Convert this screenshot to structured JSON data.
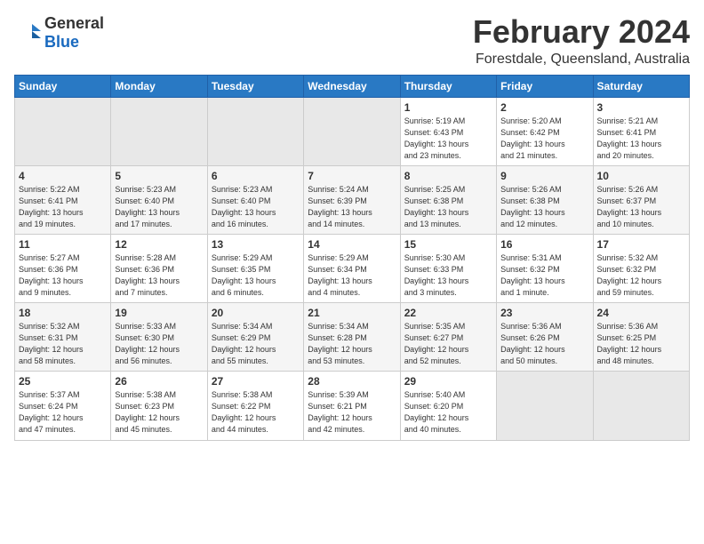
{
  "header": {
    "logo": {
      "text_general": "General",
      "text_blue": "Blue"
    },
    "month_title": "February 2024",
    "location": "Forestdale, Queensland, Australia"
  },
  "days_of_week": [
    "Sunday",
    "Monday",
    "Tuesday",
    "Wednesday",
    "Thursday",
    "Friday",
    "Saturday"
  ],
  "weeks": [
    [
      {
        "day": "",
        "info": ""
      },
      {
        "day": "",
        "info": ""
      },
      {
        "day": "",
        "info": ""
      },
      {
        "day": "",
        "info": ""
      },
      {
        "day": "1",
        "info": "Sunrise: 5:19 AM\nSunset: 6:43 PM\nDaylight: 13 hours\nand 23 minutes."
      },
      {
        "day": "2",
        "info": "Sunrise: 5:20 AM\nSunset: 6:42 PM\nDaylight: 13 hours\nand 21 minutes."
      },
      {
        "day": "3",
        "info": "Sunrise: 5:21 AM\nSunset: 6:41 PM\nDaylight: 13 hours\nand 20 minutes."
      }
    ],
    [
      {
        "day": "4",
        "info": "Sunrise: 5:22 AM\nSunset: 6:41 PM\nDaylight: 13 hours\nand 19 minutes."
      },
      {
        "day": "5",
        "info": "Sunrise: 5:23 AM\nSunset: 6:40 PM\nDaylight: 13 hours\nand 17 minutes."
      },
      {
        "day": "6",
        "info": "Sunrise: 5:23 AM\nSunset: 6:40 PM\nDaylight: 13 hours\nand 16 minutes."
      },
      {
        "day": "7",
        "info": "Sunrise: 5:24 AM\nSunset: 6:39 PM\nDaylight: 13 hours\nand 14 minutes."
      },
      {
        "day": "8",
        "info": "Sunrise: 5:25 AM\nSunset: 6:38 PM\nDaylight: 13 hours\nand 13 minutes."
      },
      {
        "day": "9",
        "info": "Sunrise: 5:26 AM\nSunset: 6:38 PM\nDaylight: 13 hours\nand 12 minutes."
      },
      {
        "day": "10",
        "info": "Sunrise: 5:26 AM\nSunset: 6:37 PM\nDaylight: 13 hours\nand 10 minutes."
      }
    ],
    [
      {
        "day": "11",
        "info": "Sunrise: 5:27 AM\nSunset: 6:36 PM\nDaylight: 13 hours\nand 9 minutes."
      },
      {
        "day": "12",
        "info": "Sunrise: 5:28 AM\nSunset: 6:36 PM\nDaylight: 13 hours\nand 7 minutes."
      },
      {
        "day": "13",
        "info": "Sunrise: 5:29 AM\nSunset: 6:35 PM\nDaylight: 13 hours\nand 6 minutes."
      },
      {
        "day": "14",
        "info": "Sunrise: 5:29 AM\nSunset: 6:34 PM\nDaylight: 13 hours\nand 4 minutes."
      },
      {
        "day": "15",
        "info": "Sunrise: 5:30 AM\nSunset: 6:33 PM\nDaylight: 13 hours\nand 3 minutes."
      },
      {
        "day": "16",
        "info": "Sunrise: 5:31 AM\nSunset: 6:32 PM\nDaylight: 13 hours\nand 1 minute."
      },
      {
        "day": "17",
        "info": "Sunrise: 5:32 AM\nSunset: 6:32 PM\nDaylight: 12 hours\nand 59 minutes."
      }
    ],
    [
      {
        "day": "18",
        "info": "Sunrise: 5:32 AM\nSunset: 6:31 PM\nDaylight: 12 hours\nand 58 minutes."
      },
      {
        "day": "19",
        "info": "Sunrise: 5:33 AM\nSunset: 6:30 PM\nDaylight: 12 hours\nand 56 minutes."
      },
      {
        "day": "20",
        "info": "Sunrise: 5:34 AM\nSunset: 6:29 PM\nDaylight: 12 hours\nand 55 minutes."
      },
      {
        "day": "21",
        "info": "Sunrise: 5:34 AM\nSunset: 6:28 PM\nDaylight: 12 hours\nand 53 minutes."
      },
      {
        "day": "22",
        "info": "Sunrise: 5:35 AM\nSunset: 6:27 PM\nDaylight: 12 hours\nand 52 minutes."
      },
      {
        "day": "23",
        "info": "Sunrise: 5:36 AM\nSunset: 6:26 PM\nDaylight: 12 hours\nand 50 minutes."
      },
      {
        "day": "24",
        "info": "Sunrise: 5:36 AM\nSunset: 6:25 PM\nDaylight: 12 hours\nand 48 minutes."
      }
    ],
    [
      {
        "day": "25",
        "info": "Sunrise: 5:37 AM\nSunset: 6:24 PM\nDaylight: 12 hours\nand 47 minutes."
      },
      {
        "day": "26",
        "info": "Sunrise: 5:38 AM\nSunset: 6:23 PM\nDaylight: 12 hours\nand 45 minutes."
      },
      {
        "day": "27",
        "info": "Sunrise: 5:38 AM\nSunset: 6:22 PM\nDaylight: 12 hours\nand 44 minutes."
      },
      {
        "day": "28",
        "info": "Sunrise: 5:39 AM\nSunset: 6:21 PM\nDaylight: 12 hours\nand 42 minutes."
      },
      {
        "day": "29",
        "info": "Sunrise: 5:40 AM\nSunset: 6:20 PM\nDaylight: 12 hours\nand 40 minutes."
      },
      {
        "day": "",
        "info": ""
      },
      {
        "day": "",
        "info": ""
      }
    ]
  ]
}
